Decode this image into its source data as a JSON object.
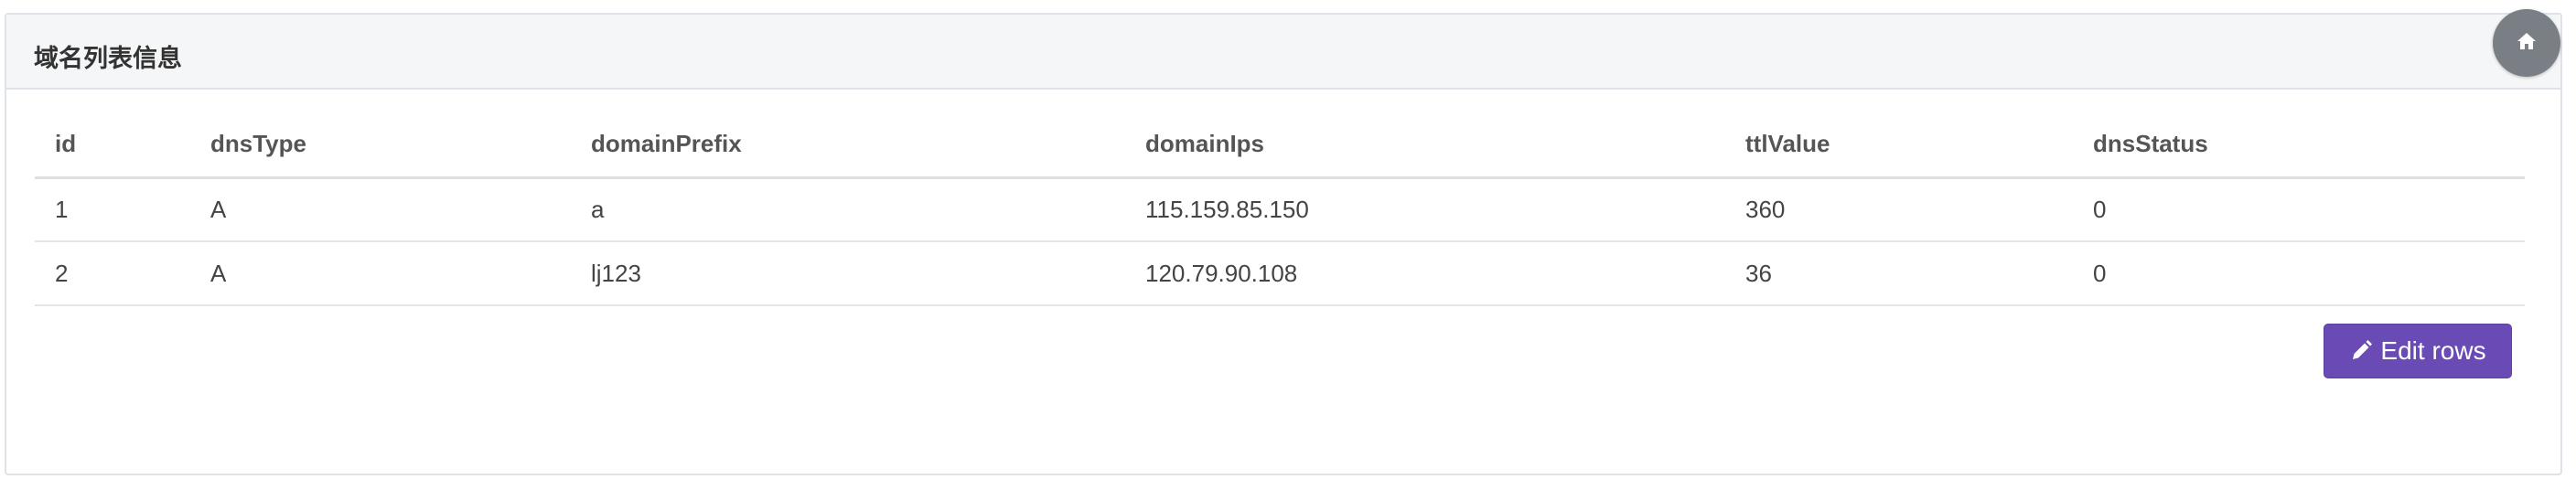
{
  "panel": {
    "title": "域名列表信息"
  },
  "home_button": {
    "icon": "home-icon"
  },
  "table": {
    "columns": [
      "id",
      "dnsType",
      "domainPrefix",
      "domainIps",
      "ttlValue",
      "dnsStatus"
    ],
    "rows": [
      [
        "1",
        "A",
        "a",
        "115.159.85.150",
        "360",
        "0"
      ],
      [
        "2",
        "A",
        "lj123",
        "120.79.90.108",
        "36",
        "0"
      ]
    ]
  },
  "edit_button": {
    "label": "Edit rows",
    "icon": "pencil-icon",
    "color": "#6a4bb5"
  }
}
